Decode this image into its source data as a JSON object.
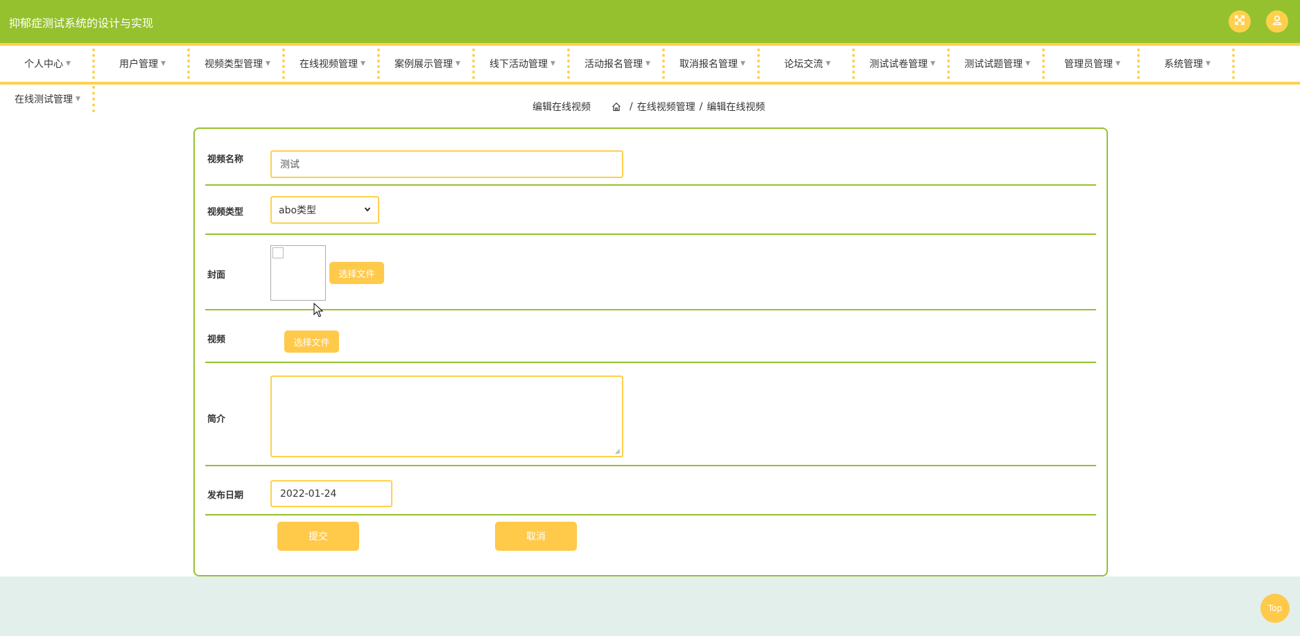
{
  "header": {
    "app_title": "抑郁症测试系统的设计与实现",
    "icons": [
      "expand-icon",
      "user-icon"
    ]
  },
  "nav": {
    "items": [
      {
        "label": "个人中心"
      },
      {
        "label": "用户管理"
      },
      {
        "label": "视频类型管理"
      },
      {
        "label": "在线视频管理"
      },
      {
        "label": "案例展示管理"
      },
      {
        "label": "线下活动管理"
      },
      {
        "label": "活动报名管理"
      },
      {
        "label": "取消报名管理"
      },
      {
        "label": "论坛交流"
      },
      {
        "label": "测试试卷管理"
      },
      {
        "label": "测试试题管理"
      },
      {
        "label": "管理员管理"
      },
      {
        "label": "系统管理"
      },
      {
        "label": "在线测试管理"
      }
    ]
  },
  "breadcrumb": {
    "page_title": "编辑在线视频",
    "items": [
      "在线视频管理",
      "编辑在线视频"
    ],
    "separator": "/"
  },
  "form": {
    "name_label": "视频名称",
    "name_value": "测试",
    "type_label": "视频类型",
    "type_value": "abo类型",
    "cover_label": "封面",
    "cover_button": "选择文件",
    "video_label": "视频",
    "video_button": "选择文件",
    "intro_label": "简介",
    "intro_value": "",
    "date_label": "发布日期",
    "date_value": "2022-01-24",
    "submit_label": "提交",
    "cancel_label": "取消"
  },
  "top_button": "Top",
  "colors": {
    "header_bg": "#95c12e",
    "accent": "#ffd04c",
    "button": "#ffc94a",
    "footer_band": "#e3efeb"
  }
}
